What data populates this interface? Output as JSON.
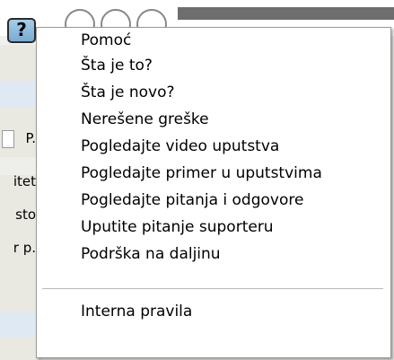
{
  "background": {
    "help_button_label": "?",
    "left_fragments": [
      "P.",
      "itet",
      "sto",
      "r p."
    ]
  },
  "menu": {
    "items": [
      "Pomoć",
      "Šta je to?",
      "Šta je novo?",
      "Nerešene greške",
      "Pogledajte video uputstva",
      "Pogledajte primer u uputstvima",
      "Pogledajte pitanja i odgovore",
      "Uputite pitanje suporteru",
      "Podrška na daljinu",
      "Interna pravila"
    ]
  }
}
